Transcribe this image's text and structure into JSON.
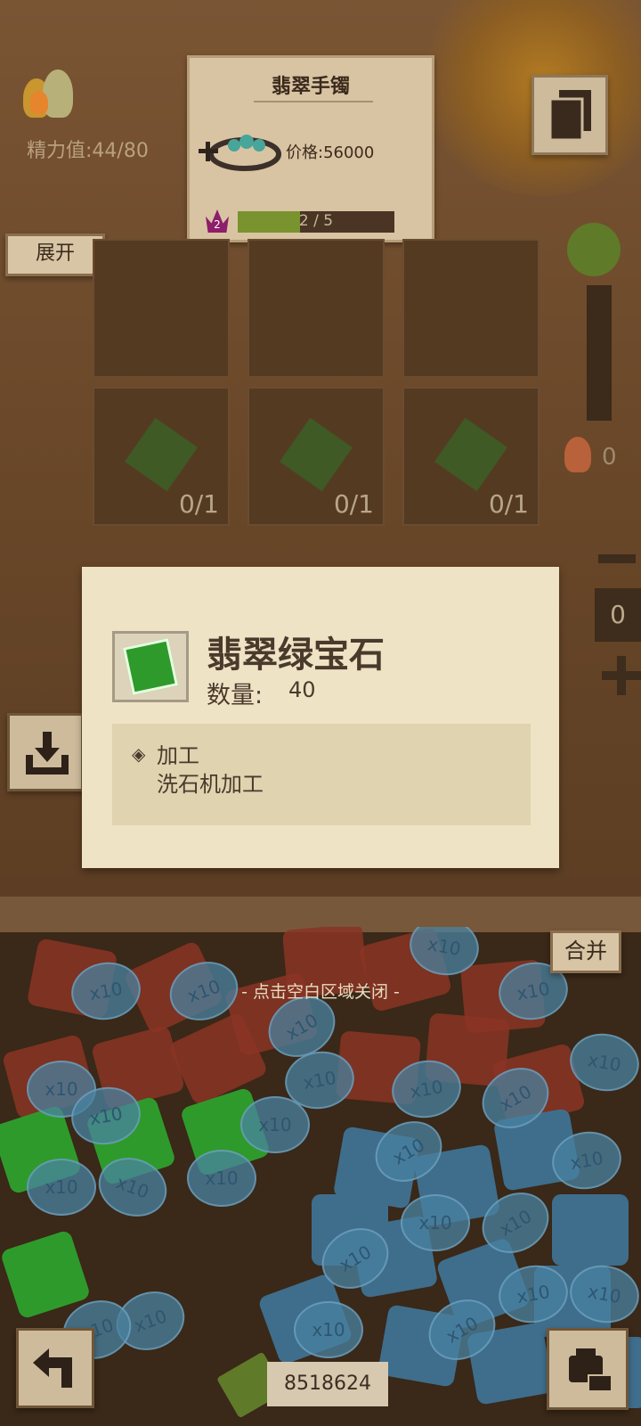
{
  "energy": {
    "label": "精力值:44/80"
  },
  "recipe_card": {
    "title": "翡翠手镯",
    "price": "价格:56000",
    "level": "2",
    "progress": {
      "current": 2,
      "total": 5,
      "text": "2 / 5"
    }
  },
  "expand_button": {
    "label": "展开"
  },
  "grid": {
    "cells": [
      {
        "count": "0/1"
      },
      {
        "count": "0/1"
      },
      {
        "count": "0/1"
      }
    ]
  },
  "side_counters": {
    "flame_count": "0",
    "stack_count": "0"
  },
  "popup": {
    "title": "翡翠绿宝石",
    "quantity_label": "数量:",
    "quantity_value": "40",
    "info_title": "加工",
    "info_desc": "洗石机加工",
    "info_bullet": "◈"
  },
  "tray": {
    "close_hint": "- 点击空白区域关闭 -",
    "merge_label": "合并",
    "token_label": "x10"
  },
  "money": {
    "amount": "8518624"
  },
  "colors": {
    "background": "#6b4a2b",
    "paper": "#efe3c6",
    "green_gem": "#2f9a2c",
    "blue_token": "#4a82a0",
    "red_gem": "#8a3424"
  },
  "icons": {
    "energy": "flame-icon",
    "pages": "pages-icon",
    "import": "import-icon",
    "back": "back-arrow-icon",
    "bag": "backpack-icon",
    "money": "money-icon"
  }
}
